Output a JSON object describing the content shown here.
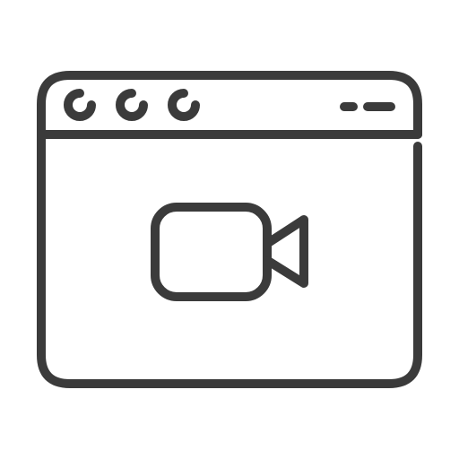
{
  "icon": {
    "name": "video-window-icon",
    "stroke_color": "#3b3b3b",
    "background_color": "#ffffff"
  },
  "window": {
    "title_bar": {
      "traffic_lights": [
        "circle-control-icon",
        "circle-control-icon",
        "circle-control-icon"
      ],
      "controls": [
        "dash-short-icon",
        "dash-long-icon"
      ]
    },
    "content": {
      "symbol": "video-camera-icon"
    }
  }
}
